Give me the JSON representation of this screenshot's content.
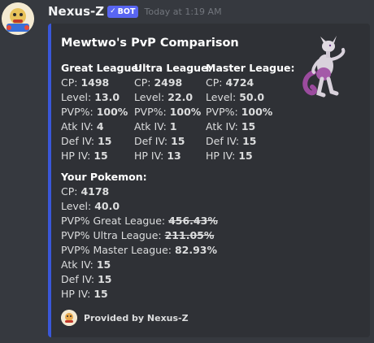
{
  "message": {
    "username": "Nexus-Z",
    "bot_tag": "BOT",
    "timestamp": "Today at 1:19 AM"
  },
  "embed": {
    "accent_color": "#3a57d9",
    "title": "Mewtwo's PvP Comparison",
    "thumbnail": "mewtwo-sprite",
    "leagues": [
      {
        "name": "Great League:",
        "rows": [
          {
            "label": "CP: ",
            "value": "1498"
          },
          {
            "label": "Level: ",
            "value": "13.0"
          },
          {
            "label": "PVP%: ",
            "value": "100%"
          },
          {
            "label": "Atk IV: ",
            "value": "4"
          },
          {
            "label": "Def IV: ",
            "value": "15"
          },
          {
            "label": "HP IV: ",
            "value": "15"
          }
        ]
      },
      {
        "name": "Ultra League:",
        "rows": [
          {
            "label": "CP: ",
            "value": "2498"
          },
          {
            "label": "Level: ",
            "value": "22.0"
          },
          {
            "label": "PVP%: ",
            "value": "100%"
          },
          {
            "label": "Atk IV: ",
            "value": "1"
          },
          {
            "label": "Def IV: ",
            "value": "15"
          },
          {
            "label": "HP IV: ",
            "value": "13"
          }
        ]
      },
      {
        "name": "Master League:",
        "rows": [
          {
            "label": "CP: ",
            "value": "4724"
          },
          {
            "label": "Level: ",
            "value": "50.0"
          },
          {
            "label": "PVP%: ",
            "value": "100%"
          },
          {
            "label": "Atk IV: ",
            "value": "15"
          },
          {
            "label": "Def IV: ",
            "value": "15"
          },
          {
            "label": "HP IV: ",
            "value": "15"
          }
        ]
      }
    ],
    "your_pokemon": {
      "name": "Your Pokemon:",
      "cp_label": "CP: ",
      "cp": "4178",
      "level_label": "Level: ",
      "level": "40.0",
      "great_label": "PVP% Great League: ",
      "great": "456.43%",
      "ultra_label": "PVP% Ultra League: ",
      "ultra": "211.05%",
      "master_label": "PVP% Master League: ",
      "master": "82.93%",
      "atk_label": "Atk IV: ",
      "atk": "15",
      "def_label": "Def IV: ",
      "def": "15",
      "hp_label": "HP IV: ",
      "hp": "15"
    },
    "footer": "Provided by Nexus-Z"
  }
}
